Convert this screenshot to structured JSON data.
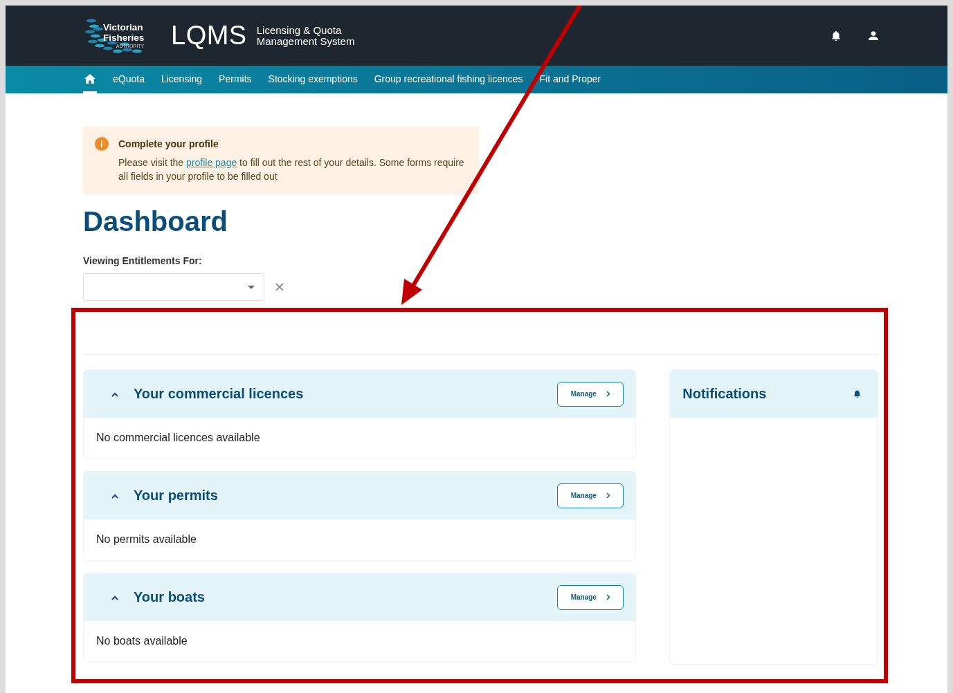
{
  "header": {
    "logo": {
      "line_1": "Victorian",
      "line_2": "Fisheries",
      "line_3": "AUTHORITY"
    },
    "app_name": "LQMS",
    "app_subtitle_1": "Licensing & Quota",
    "app_subtitle_2": "Management System"
  },
  "nav": {
    "items": [
      {
        "kind": "home",
        "selected": true
      },
      {
        "kind": "link",
        "label": "eQuota",
        "selected": false
      },
      {
        "kind": "link",
        "label": "Licensing",
        "selected": false
      },
      {
        "kind": "link",
        "label": "Permits",
        "selected": false
      },
      {
        "kind": "link",
        "label": "Stocking exemptions",
        "selected": false
      },
      {
        "kind": "link",
        "label": "Group recreational fishing licences",
        "selected": false
      },
      {
        "kind": "link",
        "label": "Fit and Proper",
        "selected": false
      }
    ]
  },
  "alert": {
    "title": "Complete your profile",
    "text_before": "Please visit the",
    "link": "profile page",
    "text_after": "to fill out the rest of your details. Some forms require all fields in your profile to be filled out"
  },
  "page_title": "Dashboard",
  "entitlements": {
    "label": "Viewing Entitlements For:"
  },
  "sections": [
    {
      "title": "Your commercial licences",
      "expanded": true,
      "button": "Manage",
      "empty_text": "No commercial licences available"
    },
    {
      "title": "Your permits",
      "expanded": true,
      "button": "Manage",
      "empty_text": "No permits available"
    },
    {
      "title": "Your boats",
      "expanded": true,
      "button": "Manage",
      "empty_text": "No boats available"
    }
  ],
  "notifications": {
    "title": "Notifications"
  },
  "annotation": {
    "kind": "arrow-to-frame"
  }
}
